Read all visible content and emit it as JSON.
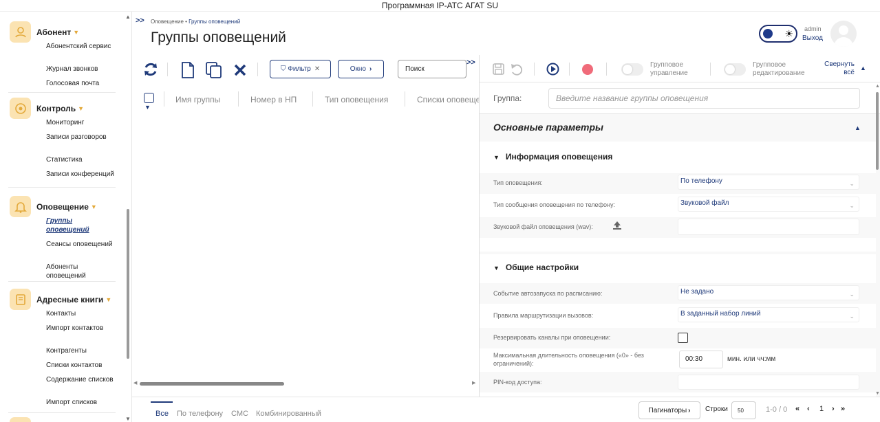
{
  "window": {
    "title": "Программная IP-АТС АГАТ SU"
  },
  "sidebar": {
    "sections": [
      {
        "title": "Абонент",
        "icon": "user-gear-icon",
        "items": [
          "Абонентский сервис",
          "Журнал звонков",
          "Голосовая почта"
        ]
      },
      {
        "title": "Контроль",
        "icon": "monitor-gauge-icon",
        "items": [
          "Мониторинг",
          "Записи разговоров",
          "Статистика",
          "Записи конференций"
        ]
      },
      {
        "title": "Оповещение",
        "icon": "bell-icon",
        "items": [
          "Группы оповещений",
          "Сеансы оповещений",
          "Абоненты оповещений"
        ]
      },
      {
        "title": "Адресные книги",
        "icon": "address-book-icon",
        "items": [
          "Контакты",
          "Импорт контактов",
          "Контрагенты",
          "Списки контактов",
          "Содержание списков",
          "Импорт списков"
        ]
      }
    ],
    "active_item": "Группы оповещений"
  },
  "header": {
    "breadcrumb": [
      "Оповещение",
      "Группы оповещений"
    ],
    "title": "Группы оповещений",
    "user": {
      "name": "admin",
      "logout": "Выход"
    }
  },
  "toolbar": {
    "filter_label": "Фильтр",
    "window_label": "Окно",
    "search_placeholder": "Поиск",
    "icons": [
      "refresh-icon",
      "new-document-icon",
      "copy-icon",
      "delete-icon"
    ]
  },
  "table": {
    "columns": [
      "Имя группы",
      "Номер в НП",
      "Тип оповещения",
      "Списки оповещения"
    ]
  },
  "bottom": {
    "tabs": [
      "Все",
      "По телефону",
      "СМС",
      "Комбинированный"
    ],
    "active_tab": "Все",
    "paginators_label": "Паги­наторы",
    "rows_label": "Строки",
    "rows_value": "50",
    "range": "1-0 / 0",
    "page": "1"
  },
  "panel": {
    "toolbar": {
      "group_control": "Групповое управление",
      "group_edit": "Групповое редактирование",
      "collapse_all": "Свернуть всё"
    },
    "group_label": "Группа:",
    "group_placeholder": "Введите название группы оповещения",
    "main_section": "Основные параметры",
    "info_section": "Информация оповещения",
    "info_fields": {
      "type_label": "Тип оповещения:",
      "type_value": "По телефону",
      "msg_type_label": "Тип сообщения оповещения по телефону:",
      "msg_type_value": "Звуковой файл",
      "sound_label": "Звуковой файл оповещения (wav):"
    },
    "general_section": "Общие настройки",
    "general_fields": {
      "autostart_label": "Событие автозапуска по расписанию:",
      "autostart_value": "Не задано",
      "routing_label": "Правила маршрутизации вызовов:",
      "routing_value": "В заданный набор линий",
      "reserve_label": "Резервировать каналы при оповещении:",
      "reserve_checked": false,
      "maxdur_label": "Максимальная длительность оповещения («0» - без ограничений):",
      "maxdur_value": "00:30",
      "maxdur_unit": "мин. или чч:мм",
      "pin_label": "PIN-код доступа:"
    }
  },
  "colors": {
    "accent": "#1f3a7a",
    "icon_bg": "#fbe3b2",
    "icon_fg": "#e3a93a",
    "record": "#f06b7a"
  }
}
